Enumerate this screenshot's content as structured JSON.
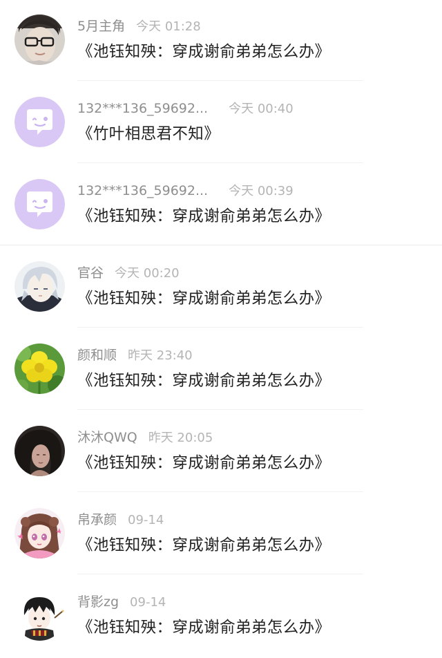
{
  "comments": [
    {
      "username": "5月主角",
      "time": "今天 01:28",
      "content": "《池钰知殃：穿成谢俞弟弟怎么办》",
      "avatar": "avatar-glasses-photo"
    },
    {
      "username": "132***136_59692...",
      "time": "今天 00:40",
      "content": "《竹叶相思君不知》",
      "avatar": "default-chat-bubble-avatar",
      "avatar_color": "#d9c8f5"
    },
    {
      "username": "132***136_59692...",
      "time": "今天 00:39",
      "content": "《池钰知殃：穿成谢俞弟弟怎么办》",
      "avatar": "default-chat-bubble-avatar",
      "avatar_color": "#d9c8f5"
    },
    {
      "username": "官谷",
      "time": "今天 00:20",
      "content": "《池钰知殃：穿成谢俞弟弟怎么办》",
      "avatar": "avatar-anime-silver-hair"
    },
    {
      "username": "颜和顺",
      "time": "昨天 23:40",
      "content": "《池钰知殃：穿成谢俞弟弟怎么办》",
      "avatar": "avatar-yellow-flower"
    },
    {
      "username": "沐沐QWQ",
      "time": "昨天 20:05",
      "content": "《池钰知殃：穿成谢俞弟弟怎么办》",
      "avatar": "avatar-dark-portrait"
    },
    {
      "username": "帛承颜",
      "time": "09-14",
      "content": "《池钰知殃：穿成谢俞弟弟怎么办》",
      "avatar": "avatar-anime-girl-pink"
    },
    {
      "username": "背影zg",
      "time": "09-14",
      "content": "《池钰知殃：穿成谢俞弟弟怎么办》",
      "avatar": "avatar-anime-boy-scarf"
    }
  ]
}
